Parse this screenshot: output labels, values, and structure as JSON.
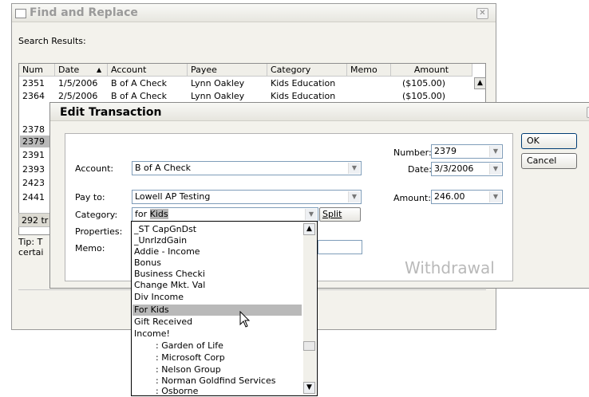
{
  "find_replace": {
    "title": "Find and Replace",
    "search_results_label": "Search Results:",
    "columns": [
      "Num",
      "Date",
      "Account",
      "Payee",
      "Category",
      "Memo",
      "Amount"
    ],
    "sort_indicator": "▲",
    "rows": [
      [
        "2351",
        "1/5/2006",
        "B of A Check",
        "Lynn Oakley",
        "Kids Education",
        "",
        "($105.00)"
      ],
      [
        "2364",
        "2/5/2006",
        "B of A Check",
        "Lynn Oakley",
        "Kids Education",
        "",
        "($105.00)"
      ]
    ],
    "partial_nums": [
      "2378",
      "2379",
      "2391",
      "2393",
      "2423",
      "2441"
    ],
    "status_text": "292 tr",
    "tip_lines": [
      "Tip: T",
      "certai"
    ]
  },
  "edit_transaction": {
    "title": "Edit Transaction",
    "account_label": "Account:",
    "account_value": "B of A Check",
    "payto_label": "Pay to:",
    "payto_value": "Lowell AP Testing",
    "category_label": "Category:",
    "category_value_prefix": "for ",
    "category_value_selected": "Kids",
    "split_label": "Split",
    "properties_label": "Properties:",
    "memo_label": "Memo:",
    "number_label": "Number:",
    "number_value": "2379",
    "date_label": "Date:",
    "date_value": "3/3/2006",
    "amount_label": "Amount:",
    "amount_value": "246.00",
    "ok_label": "OK",
    "cancel_label": "Cancel",
    "type_watermark": "Withdrawal"
  },
  "category_list": {
    "items": [
      "_ST CapGnDst",
      "_UnrlzdGain",
      "Addie - Income",
      "Bonus",
      "Business Checki",
      "Change Mkt. Val",
      "Div Income",
      "For Kids",
      "Gift Received",
      "Income!",
      ": Garden of Life",
      ": Microsoft Corp",
      ": Nelson Group",
      ": Norman Goldfind Services",
      ": Osborne"
    ],
    "selected_index": 7
  },
  "colors": {
    "window_bg": "#f3f2ec",
    "selection": "#b9b9b9",
    "button_border": "#003c74"
  }
}
